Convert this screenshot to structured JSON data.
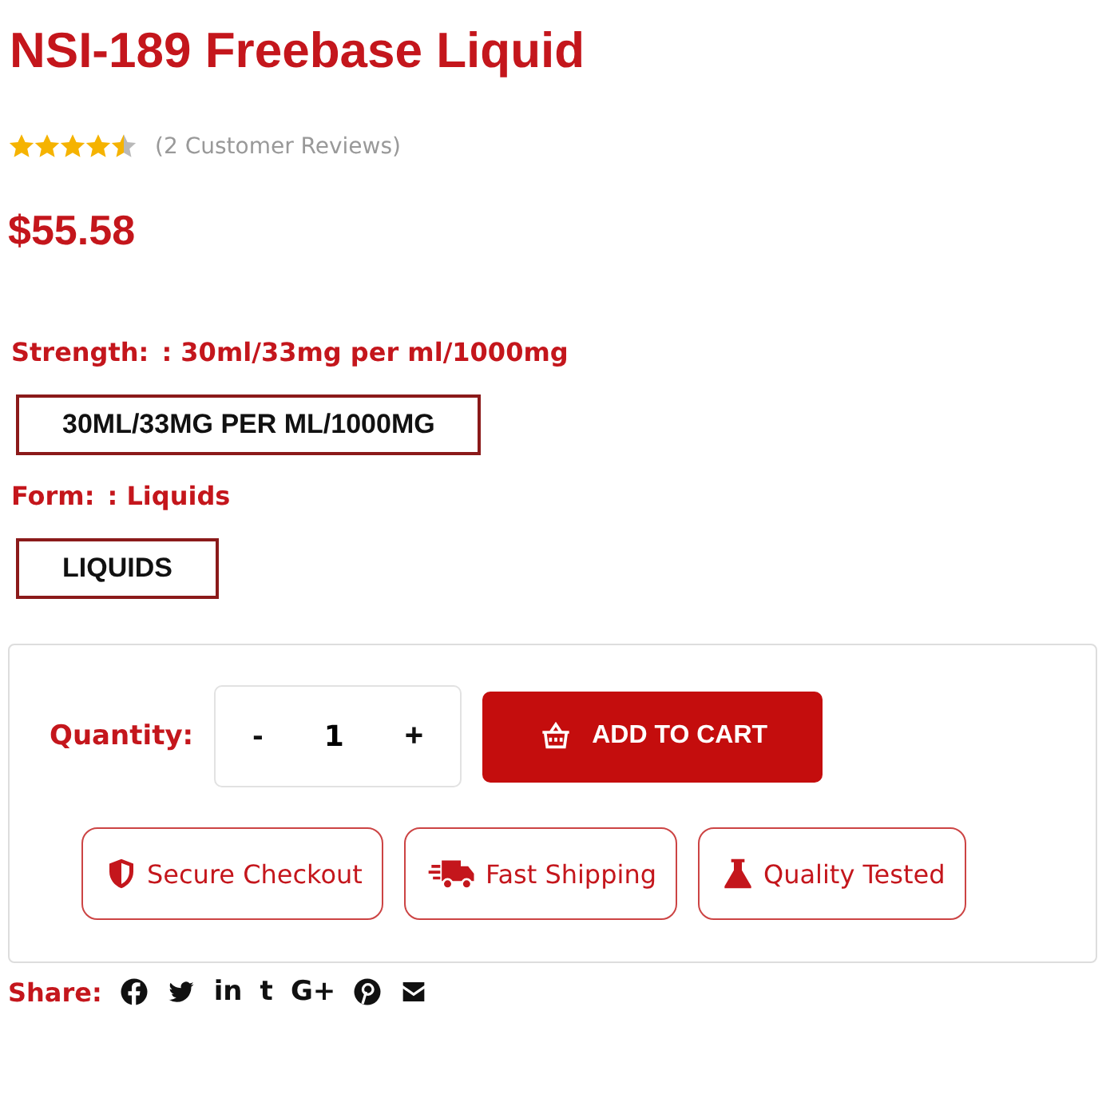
{
  "product": {
    "title": "NSI-189 Freebase Liquid",
    "stars": 4.5,
    "reviews": "(2 Customer Reviews)",
    "price": "$55.58"
  },
  "attributes": [
    {
      "label": "Strength:",
      "value": ": 30ml/33mg per ml/1000mg",
      "options": [
        {
          "label": "30ML/33MG PER ML/1000MG",
          "selected": true
        }
      ]
    },
    {
      "label": "Form:",
      "value": ": Liquids",
      "options": [
        {
          "label": "LIQUIDS",
          "selected": true
        }
      ]
    }
  ],
  "purchase": {
    "quantity_label": "Quantity:",
    "minus": "-",
    "quantity": "1",
    "plus": "+",
    "button": "ADD TO CART"
  },
  "badges": [
    {
      "kind": "shield",
      "label": "Secure Checkout"
    },
    {
      "kind": "truck",
      "label": "Fast Shipping"
    },
    {
      "kind": "flask",
      "label": "Quality Tested"
    }
  ],
  "share": {
    "label": "Share:",
    "icons": [
      {
        "kind": "facebook"
      },
      {
        "kind": "twitter"
      },
      {
        "kind": "glyph",
        "glyph": "in"
      },
      {
        "kind": "glyph",
        "glyph": "t"
      },
      {
        "kind": "glyph",
        "glyph": "G+"
      },
      {
        "kind": "pinterest"
      },
      {
        "kind": "mail"
      }
    ]
  }
}
